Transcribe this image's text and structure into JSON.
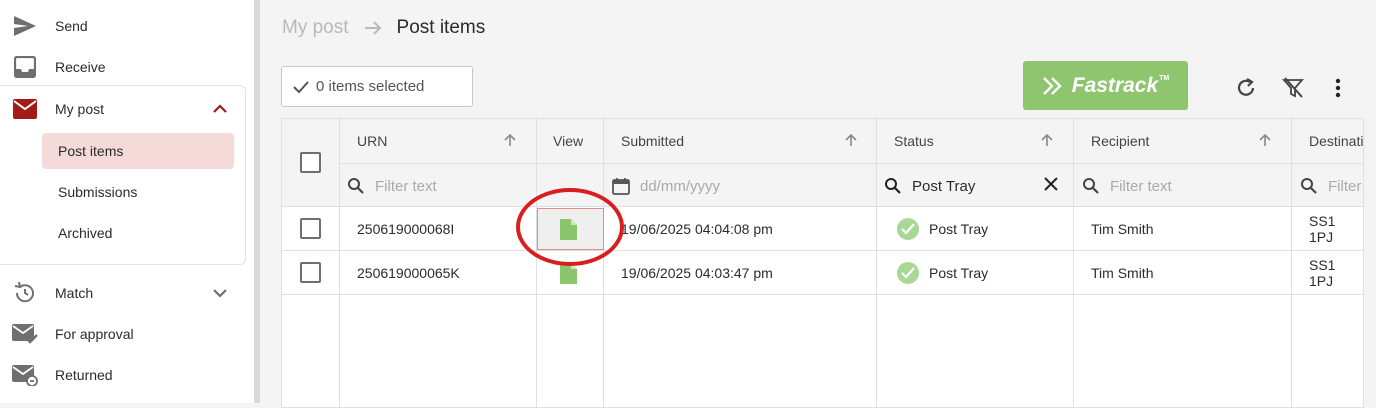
{
  "sidebar": {
    "send": "Send",
    "receive": "Receive",
    "my_post": "My post",
    "post_items": "Post items",
    "submissions": "Submissions",
    "archived": "Archived",
    "match": "Match",
    "for_approval": "For approval",
    "returned": "Returned"
  },
  "breadcrumb": {
    "parent": "My post",
    "current": "Post items"
  },
  "toolbar": {
    "selected_text": "0 items selected",
    "fastrack_label": "Fastrack",
    "fastrack_tm": "TM"
  },
  "grid": {
    "columns": {
      "urn": "URN",
      "view": "View",
      "submitted": "Submitted",
      "status": "Status",
      "recipient": "Recipient",
      "destination": "Destinati"
    },
    "filters": {
      "urn_placeholder": "Filter text",
      "submitted_placeholder": "dd/mm/yyyy",
      "status_value": "Post Tray",
      "recipient_placeholder": "Filter text",
      "destination_placeholder": "Filter"
    },
    "rows": [
      {
        "urn": "250619000068I",
        "submitted": "19/06/2025 04:04:08 pm",
        "status": "Post Tray",
        "recipient": "Tim Smith",
        "destination": "SS1 1PJ"
      },
      {
        "urn": "250619000065K",
        "submitted": "19/06/2025 04:03:47 pm",
        "status": "Post Tray",
        "recipient": "Tim Smith",
        "destination": "SS1 1PJ"
      }
    ]
  },
  "colors": {
    "brand_red": "#a31a1a",
    "fastrack_green": "#8fc56f",
    "active_bg": "#f5dada",
    "status_green": "#a8d895"
  }
}
